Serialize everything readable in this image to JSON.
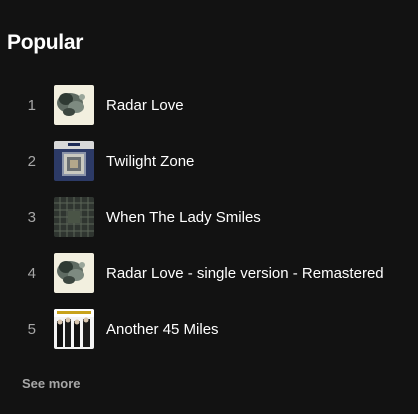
{
  "section": {
    "title": "Popular"
  },
  "tracks": [
    {
      "number": "1",
      "title": "Radar Love",
      "art": "smoke-art-icon"
    },
    {
      "number": "2",
      "title": "Twilight Zone",
      "art": "cut-art-icon"
    },
    {
      "number": "3",
      "title": "When The Lady Smiles",
      "art": "dark-grid-art-icon"
    },
    {
      "number": "4",
      "title": "Radar Love - single version - Remastered",
      "art": "smoke-art-icon"
    },
    {
      "number": "5",
      "title": "Another 45 Miles",
      "art": "band-photo-art-icon"
    }
  ],
  "footer": {
    "see_more_label": "See more"
  }
}
